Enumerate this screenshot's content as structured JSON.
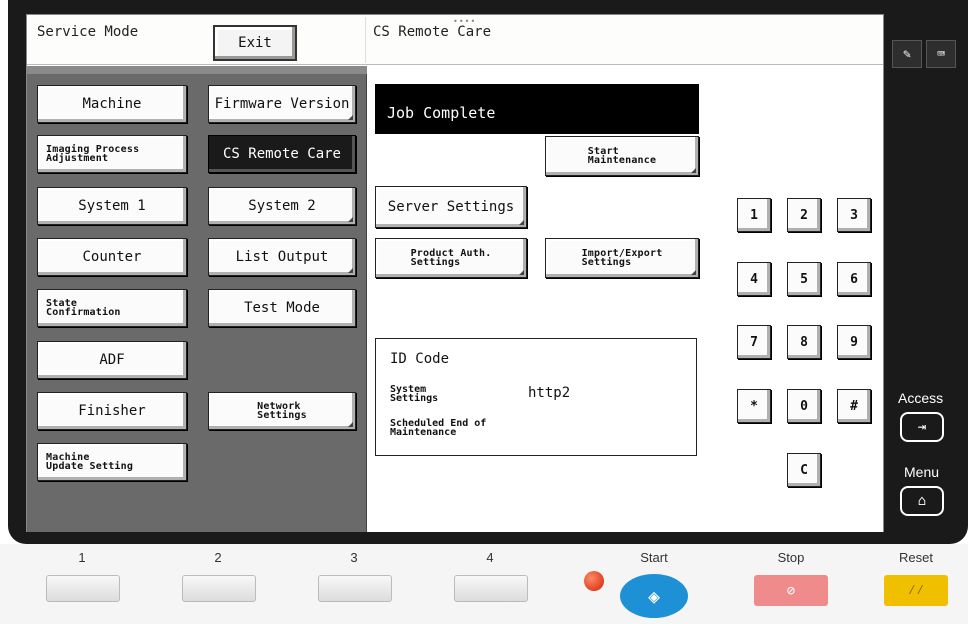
{
  "header": {
    "title": "Service Mode",
    "exit_label": "Exit",
    "screen_title": "CS Remote Care"
  },
  "menu_left": [
    {
      "label": "Machine",
      "selected": false
    },
    {
      "label": "Imaging Process\nAdjustment",
      "selected": false
    },
    {
      "label": "System 1",
      "selected": false
    },
    {
      "label": "Counter",
      "selected": false
    },
    {
      "label": "State\nConfirmation",
      "selected": false
    },
    {
      "label": "ADF",
      "selected": false
    },
    {
      "label": "Finisher",
      "selected": false
    },
    {
      "label": "Machine\nUpdate Setting",
      "selected": false
    }
  ],
  "menu_right": [
    {
      "label": "Firmware Version",
      "selected": false
    },
    {
      "label": "CS Remote Care",
      "selected": true
    },
    {
      "label": "System 2",
      "selected": false
    },
    {
      "label": "List Output",
      "selected": false
    },
    {
      "label": "Test Mode",
      "selected": false
    },
    {
      "label": "Network\nSettings",
      "selected": false
    }
  ],
  "pane": {
    "status": "Job Complete",
    "start_maintenance": "Start\nMaintenance",
    "server_settings": "Server Settings",
    "product_auth": "Product Auth.\nSettings",
    "import_export": "Import/Export\nSettings",
    "id_code_label": "ID Code",
    "system_settings_label": "System\nSettings",
    "system_settings_value": "http2",
    "scheduled_end_label": "Scheduled End of\nMaintenance"
  },
  "keypad": [
    "1",
    "2",
    "3",
    "4",
    "5",
    "6",
    "7",
    "8",
    "9",
    "*",
    "0",
    "#",
    "C"
  ],
  "side": {
    "access_label": "Access",
    "menu_label": "Menu"
  },
  "hardware": {
    "keys": [
      "1",
      "2",
      "3",
      "4"
    ],
    "start_label": "Start",
    "stop_label": "Stop",
    "reset_label": "Reset"
  },
  "colors": {
    "start": "#1e90d6",
    "stop": "#f08b8b",
    "reset": "#f0c000",
    "led": "#d42000"
  }
}
